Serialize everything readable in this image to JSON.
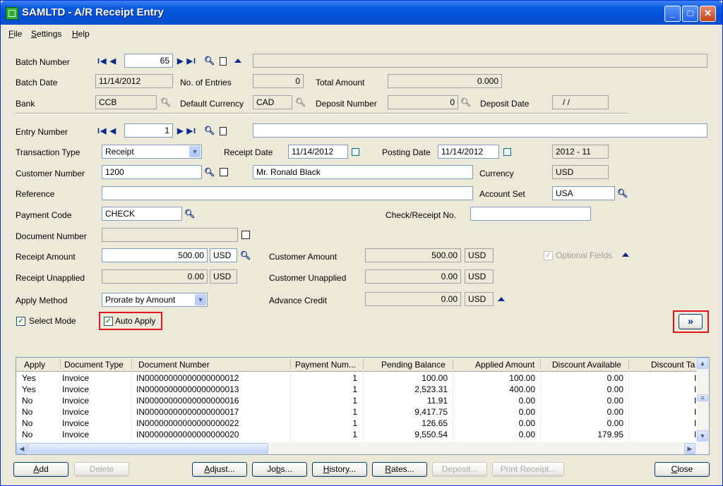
{
  "window": {
    "title": "SAMLTD - A/R Receipt Entry"
  },
  "menu": [
    {
      "label": "File",
      "underline": "F",
      "rest": "ile"
    },
    {
      "label": "Settings",
      "underline": "S",
      "rest": "ettings"
    },
    {
      "label": "Help",
      "underline": "H",
      "rest": "elp"
    }
  ],
  "batch": {
    "number_label": "Batch Number",
    "number": "65",
    "description": "",
    "date_label": "Batch Date",
    "date": "11/14/2012",
    "entries_label": "No. of Entries",
    "entries": "0",
    "total_label": "Total Amount",
    "total": "0.000",
    "bank_label": "Bank",
    "bank": "CCB",
    "currency_label": "Default Currency",
    "currency": "CAD",
    "deposit_label": "Deposit Number",
    "deposit": "0",
    "deposit_date_label": "Deposit Date",
    "deposit_date": "/ /"
  },
  "entry": {
    "number_label": "Entry Number",
    "number": "1",
    "description": "",
    "type_label": "Transaction Type",
    "type": "Receipt",
    "receipt_date_label": "Receipt Date",
    "receipt_date": "11/14/2012",
    "posting_date_label": "Posting Date",
    "posting_date": "11/14/2012",
    "period": "2012 - 11",
    "customer_label": "Customer Number",
    "customer": "1200",
    "customer_name": "Mr. Ronald Black",
    "currency_label": "Currency",
    "currency": "USD",
    "reference_label": "Reference",
    "reference": "",
    "account_set_label": "Account Set",
    "account_set": "USA",
    "payment_code_label": "Payment Code",
    "payment_code": "CHECK",
    "check_label": "Check/Receipt No.",
    "check": "",
    "document_label": "Document Number",
    "document": "",
    "receipt_amount_label": "Receipt Amount",
    "receipt_amount": "500.00",
    "receipt_currency": "USD",
    "customer_amount_label": "Customer Amount",
    "customer_amount": "500.00",
    "customer_amount_currency": "USD",
    "optional_fields_label": "Optional Fields",
    "receipt_unapplied_label": "Receipt Unapplied",
    "receipt_unapplied": "0.00",
    "receipt_unapplied_currency": "USD",
    "customer_unapplied_label": "Customer Unapplied",
    "customer_unapplied": "0.00",
    "customer_unapplied_currency": "USD",
    "apply_method_label": "Apply Method",
    "apply_method": "Prorate by Amount",
    "advance_credit_label": "Advance Credit",
    "advance_credit": "0.00",
    "advance_credit_currency": "USD",
    "select_mode_label": "Select Mode",
    "select_mode_checked": true,
    "auto_apply_label": "Auto Apply",
    "auto_apply_checked": true,
    "forward_label": "»"
  },
  "grid": {
    "columns": [
      "Apply",
      "Document Type",
      "Document Number",
      "Payment Num...",
      "Pending Balance",
      "Applied Amount",
      "Discount Available",
      "Discount Ta"
    ],
    "rows": [
      [
        "Yes",
        "Invoice",
        "IN00000000000000000012",
        "1",
        "100.00",
        "100.00",
        "0.00",
        "I"
      ],
      [
        "Yes",
        "Invoice",
        "IN00000000000000000013",
        "1",
        "2,523.31",
        "400.00",
        "0.00",
        "I"
      ],
      [
        "No",
        "Invoice",
        "IN00000000000000000016",
        "1",
        "11.91",
        "0.00",
        "0.00",
        "I"
      ],
      [
        "No",
        "Invoice",
        "IN00000000000000000017",
        "1",
        "9,417.75",
        "0.00",
        "0.00",
        "I"
      ],
      [
        "No",
        "Invoice",
        "IN00000000000000000022",
        "1",
        "126.65",
        "0.00",
        "0.00",
        "I"
      ],
      [
        "No",
        "Invoice",
        "IN00000000000000000020",
        "1",
        "9,550.54",
        "0.00",
        "179.95",
        "I"
      ]
    ]
  },
  "buttons": {
    "add": {
      "label": "Add",
      "u": "A",
      "rest": "dd"
    },
    "delete": "Delete",
    "adjust": {
      "label": "Adjust...",
      "u": "A",
      "rest": "djust..."
    },
    "jobs": {
      "label": "Jobs...",
      "pre": "Jo",
      "u": "b",
      "rest": "s..."
    },
    "history": {
      "label": "History...",
      "u": "H",
      "rest": "istory..."
    },
    "rates": {
      "label": "Rates...",
      "u": "R",
      "rest": "ates..."
    },
    "deposit": "Deposit...",
    "print_receipt": "Print Receipt...",
    "close": {
      "label": "Close",
      "u": "C",
      "rest": "lose"
    }
  }
}
